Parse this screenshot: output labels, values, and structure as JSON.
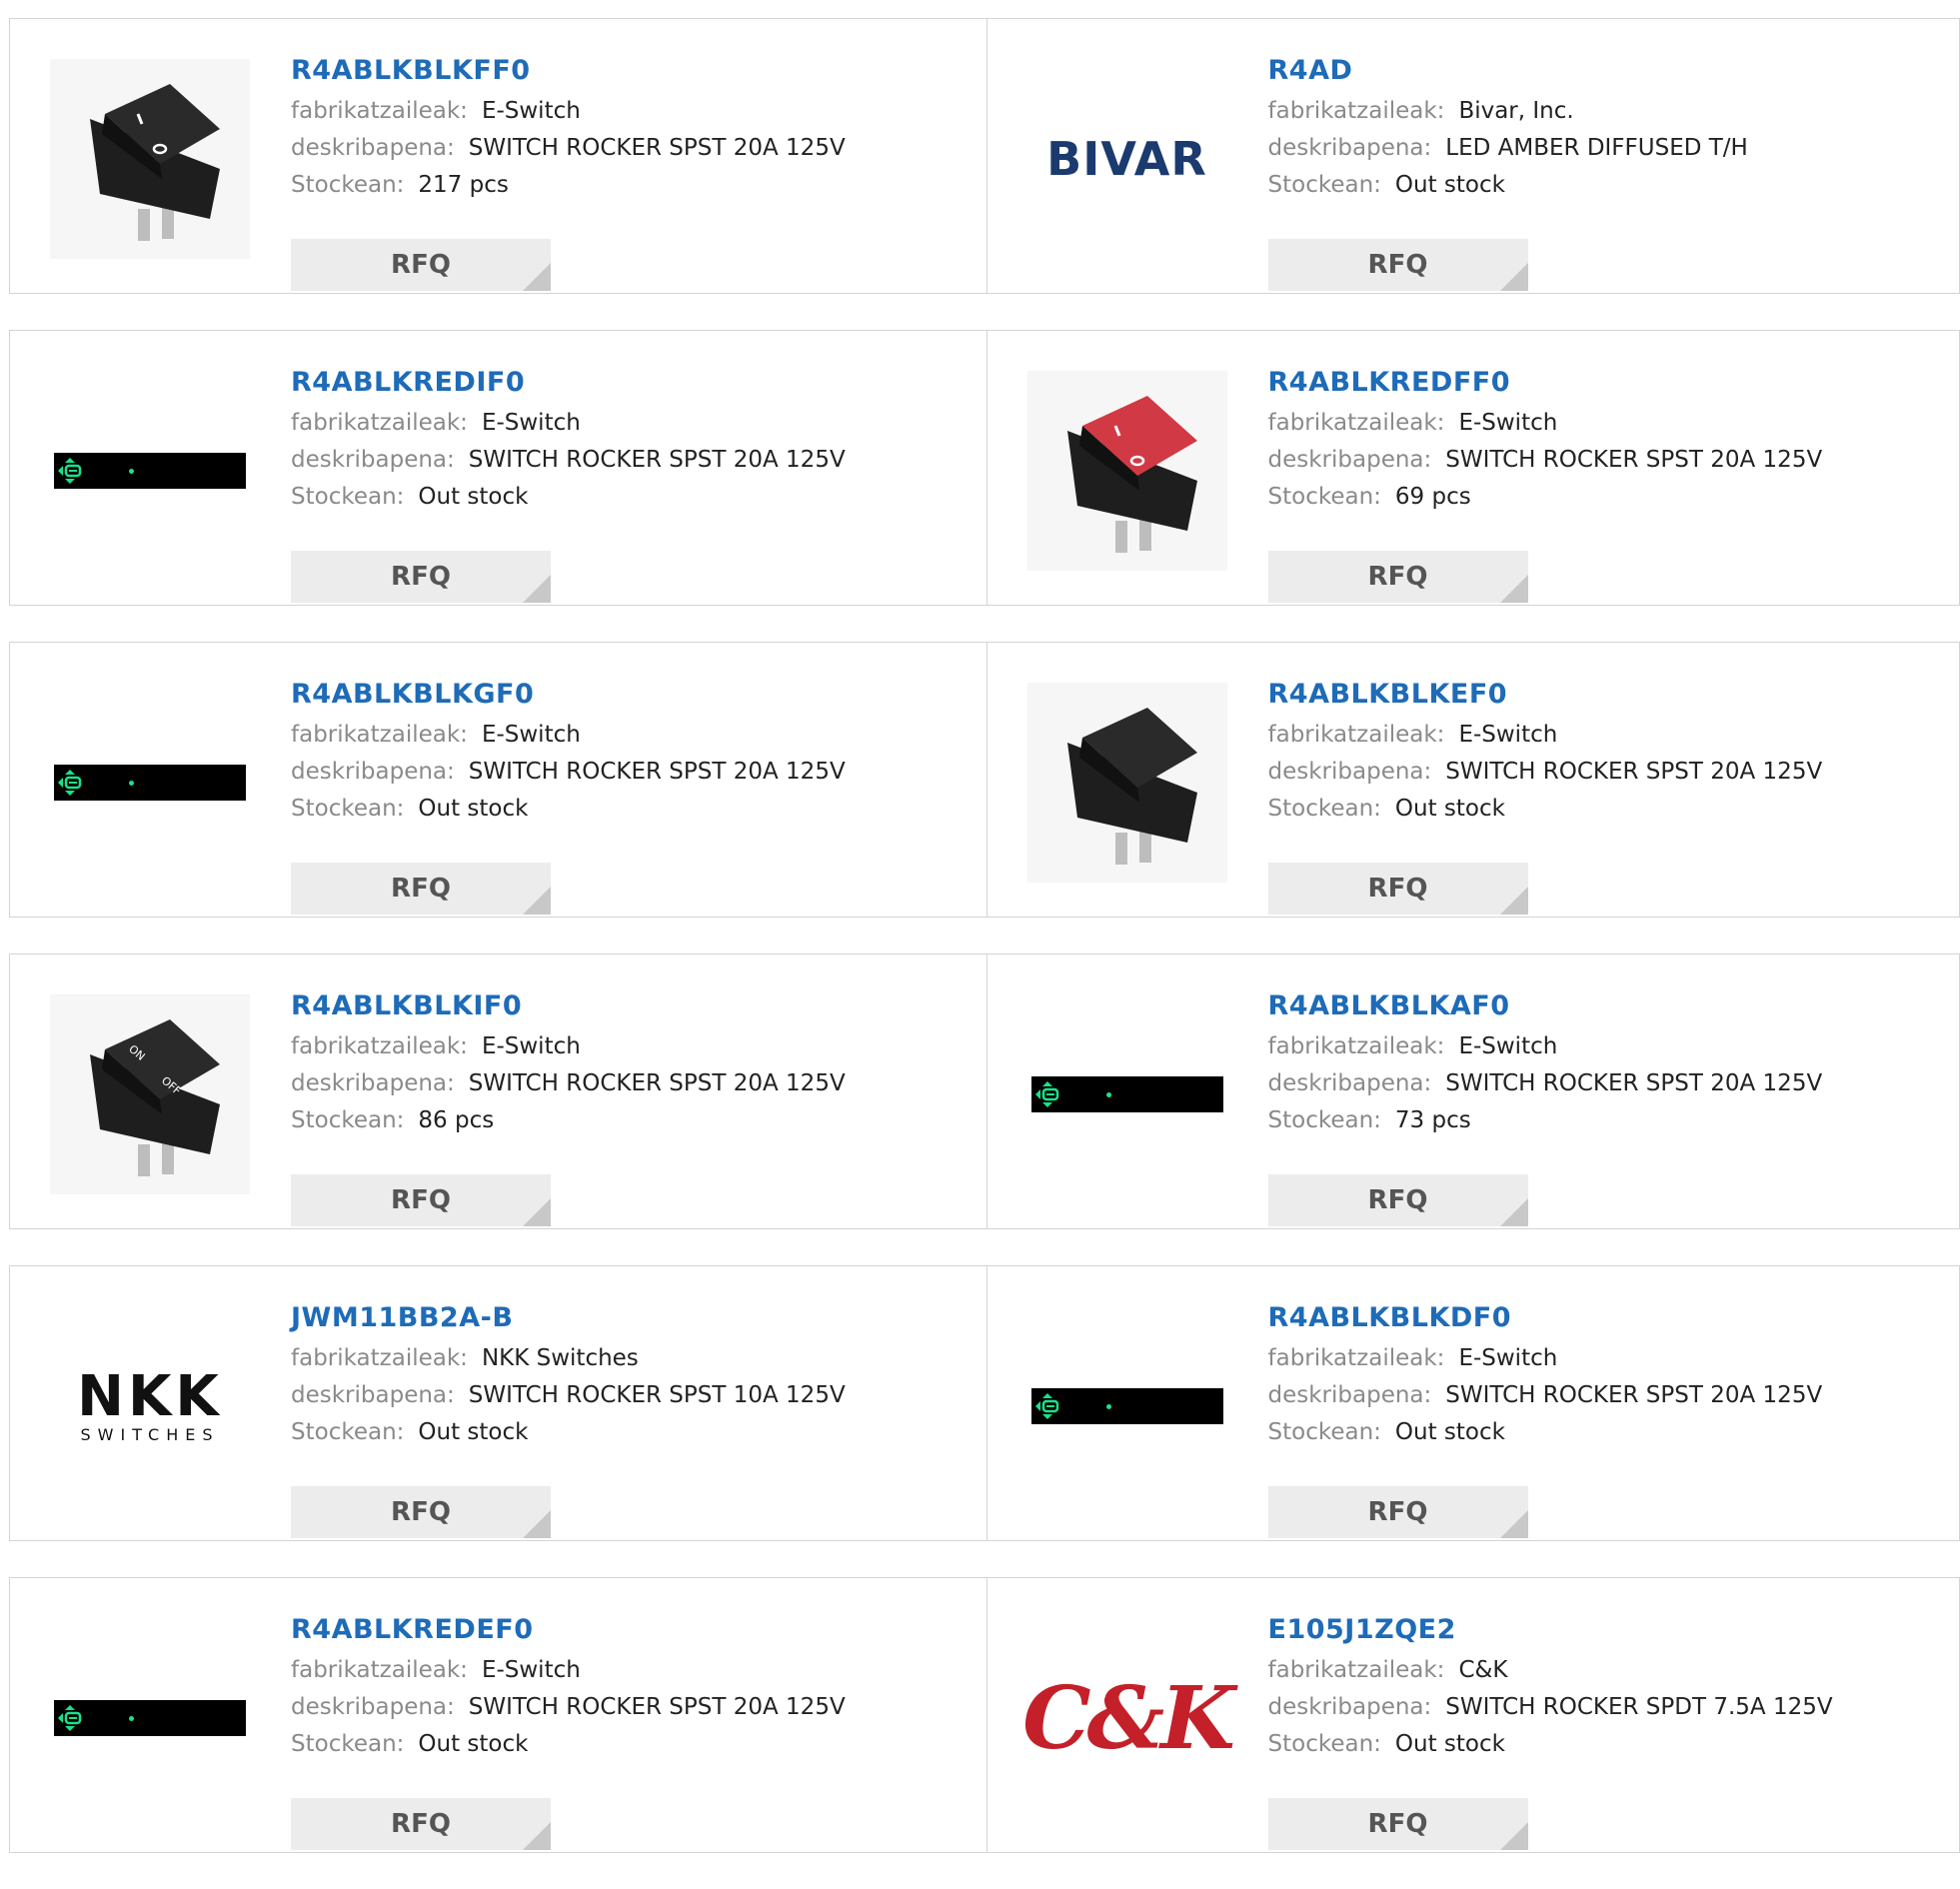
{
  "labels": {
    "manufacturer": "fabrikatzaileak:",
    "description": "deskribapena:",
    "stock": "Stockean:",
    "rfq": "RFQ"
  },
  "products": [
    {
      "pn": "R4ABLKBLKFF0",
      "manufacturer": "E-Switch",
      "description": "SWITCH ROCKER SPST 20A 125V",
      "stock": "217 pcs",
      "image": "black-rocker-switch"
    },
    {
      "pn": "R4AD",
      "manufacturer": "Bivar, Inc.",
      "description": "LED AMBER DIFFUSED T/H",
      "stock": "Out stock",
      "image": "bivar-logo",
      "logo_text": "BIVAR"
    },
    {
      "pn": "R4ABLKREDIF0",
      "manufacturer": "E-Switch",
      "description": "SWITCH ROCKER SPST 20A 125V",
      "stock": "Out stock",
      "image": "led-display"
    },
    {
      "pn": "R4ABLKREDFF0",
      "manufacturer": "E-Switch",
      "description": "SWITCH ROCKER SPST 20A 125V",
      "stock": "69 pcs",
      "image": "red-rocker-switch"
    },
    {
      "pn": "R4ABLKBLKGF0",
      "manufacturer": "E-Switch",
      "description": "SWITCH ROCKER SPST 20A 125V",
      "stock": "Out stock",
      "image": "led-display"
    },
    {
      "pn": "R4ABLKBLKEF0",
      "manufacturer": "E-Switch",
      "description": "SWITCH ROCKER SPST 20A 125V",
      "stock": "Out stock",
      "image": "black-rocker-switch-plain"
    },
    {
      "pn": "R4ABLKBLKIF0",
      "manufacturer": "E-Switch",
      "description": "SWITCH ROCKER SPST 20A 125V",
      "stock": "86 pcs",
      "image": "on-off-rocker-switch",
      "switch_on": "ON",
      "switch_off": "OFF"
    },
    {
      "pn": "R4ABLKBLKAF0",
      "manufacturer": "E-Switch",
      "description": "SWITCH ROCKER SPST 20A 125V",
      "stock": "73 pcs",
      "image": "led-display"
    },
    {
      "pn": "JWM11BB2A-B",
      "manufacturer": "NKK Switches",
      "description": "SWITCH ROCKER SPST 10A 125V",
      "stock": "Out stock",
      "image": "nkk-logo",
      "logo_text": "NKK",
      "logo_sub": "SWITCHES"
    },
    {
      "pn": "R4ABLKBLKDF0",
      "manufacturer": "E-Switch",
      "description": "SWITCH ROCKER SPST 20A 125V",
      "stock": "Out stock",
      "image": "led-display"
    },
    {
      "pn": "R4ABLKREDEF0",
      "manufacturer": "E-Switch",
      "description": "SWITCH ROCKER SPST 20A 125V",
      "stock": "Out stock",
      "image": "led-display"
    },
    {
      "pn": "E105J1ZQE2",
      "manufacturer": "C&K",
      "description": "SWITCH ROCKER SPDT 7.5A 125V",
      "stock": "Out stock",
      "image": "ck-logo",
      "logo_text": "C&K"
    }
  ]
}
